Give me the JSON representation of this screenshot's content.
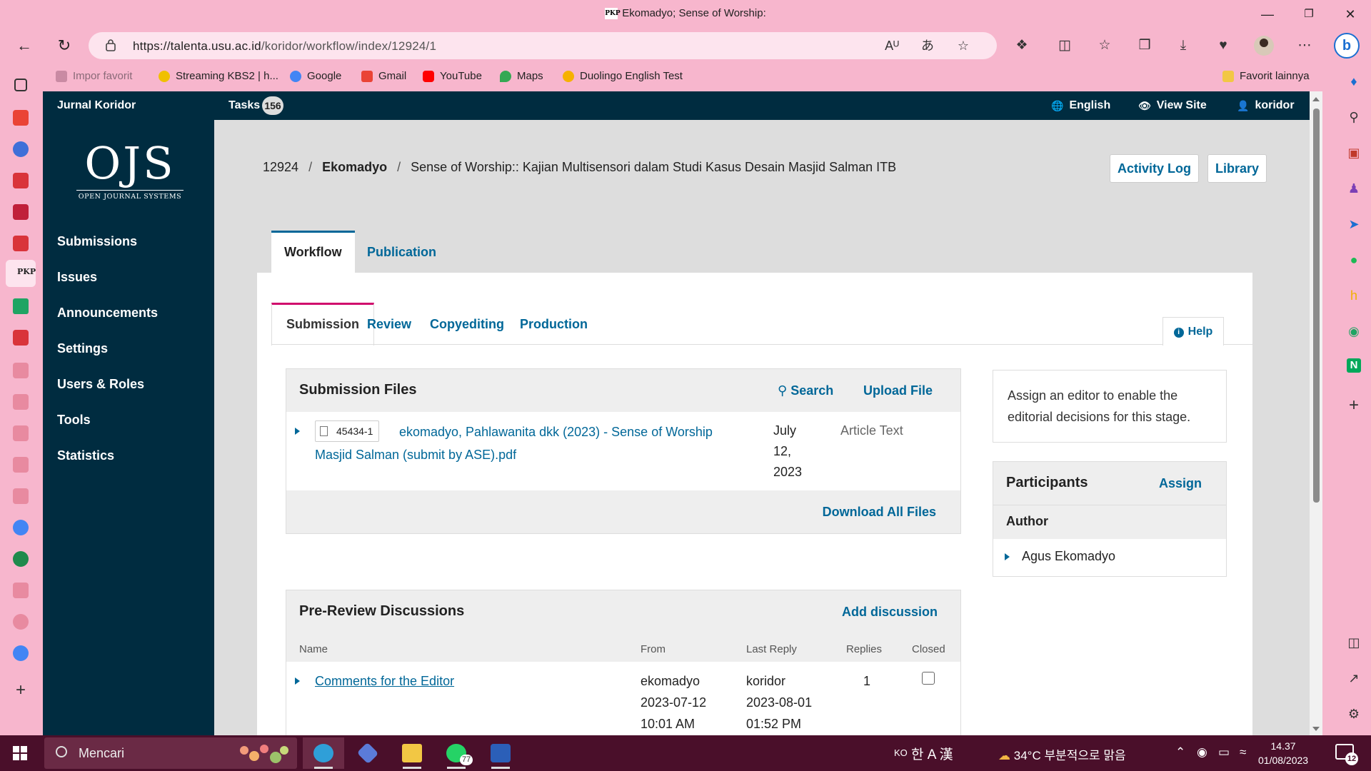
{
  "browser": {
    "title": "Ekomadyo; Sense of Worship:",
    "favicon_text": "PKP",
    "url_host": "https://talenta.usu.ac.id",
    "url_path": "/koridor/workflow/index/12924/1"
  },
  "favorites": {
    "import": "Impor favorit",
    "items": [
      "Streaming KBS2 | h...",
      "Google",
      "Gmail",
      "YouTube",
      "Maps",
      "Duolingo English Test"
    ],
    "other": "Favorit lainnya"
  },
  "ojs": {
    "context": "Jurnal Koridor",
    "tasks_label": "Tasks",
    "tasks_count": "156",
    "language": "English",
    "view_site": "View Site",
    "user": "koridor",
    "logo_big": "OJS",
    "logo_small": "OPEN JOURNAL SYSTEMS",
    "nav": [
      "Submissions",
      "Issues",
      "Announcements",
      "Settings",
      "Users & Roles",
      "Tools",
      "Statistics"
    ]
  },
  "submission": {
    "id": "12924",
    "author": "Ekomadyo",
    "title": "Sense of Worship:: Kajian Multisensori dalam Studi Kasus Desain Masjid Salman ITB",
    "activity_log": "Activity Log",
    "library": "Library"
  },
  "tabs": {
    "workflow": "Workflow",
    "publication": "Publication"
  },
  "stages": {
    "submission": "Submission",
    "review": "Review",
    "copyediting": "Copyediting",
    "production": "Production",
    "help": "Help"
  },
  "files": {
    "title": "Submission Files",
    "search": "Search",
    "upload": "Upload File",
    "row": {
      "id": "45434-1",
      "name": "ekomadyo, Pahlawanita dkk (2023) - Sense of Worship Masjid Salman (submit by ASE).pdf",
      "date": "July 12, 2023",
      "type": "Article Text"
    },
    "download_all": "Download All Files"
  },
  "discussions": {
    "title": "Pre-Review Discussions",
    "add": "Add discussion",
    "columns": [
      "Name",
      "From",
      "Last Reply",
      "Replies",
      "Closed"
    ],
    "row": {
      "name": "Comments for the Editor",
      "from_user": "ekomadyo",
      "from_date": "2023-07-12",
      "from_time": "10:01 AM",
      "reply_user": "koridor",
      "reply_date": "2023-08-01",
      "reply_time": "01:52 PM",
      "replies": "1"
    }
  },
  "editor_notice": "Assign an editor to enable the editorial decisions for this stage.",
  "participants": {
    "title": "Participants",
    "assign": "Assign",
    "role": "Author",
    "name": "Agus Ekomadyo"
  },
  "taskbar": {
    "search": "Mencari",
    "whatsapp_badge": "77",
    "ime_lang": "KO",
    "ime_chars": "한 A 漢",
    "weather": "34°C 부분적으로 맑음",
    "time": "14.37",
    "date": "01/08/2023",
    "notif_count": "12"
  },
  "colors": {
    "ojs_nav": "#002c40",
    "link": "#006798",
    "stage_accent": "#d00a6c",
    "browser": "#f7b6cd",
    "taskbar": "#4a0f2a"
  }
}
